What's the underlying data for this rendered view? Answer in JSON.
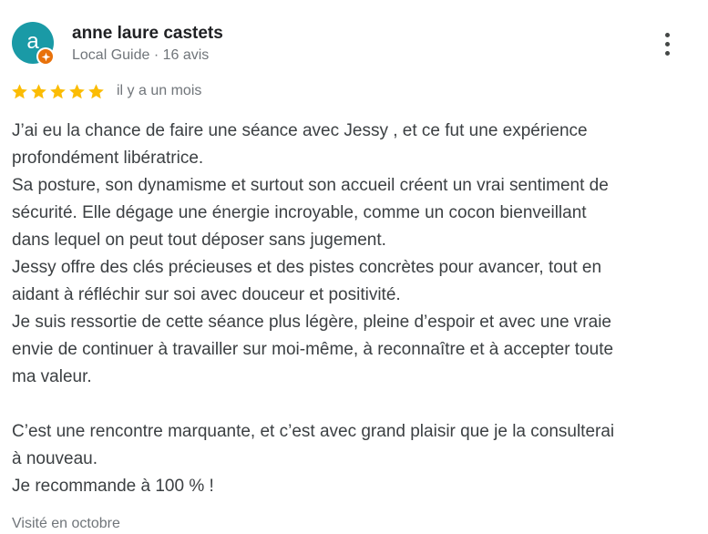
{
  "author": {
    "initial": "a",
    "name": "anne laure castets",
    "meta": "Local Guide · 16 avis"
  },
  "icons": {
    "avatar_color": "#1a9aa6",
    "badge": "local-guide-badge-icon",
    "badge_color": "#e8710a",
    "menu": "more-vert-icon",
    "star": "star-icon",
    "star_color": "#fbbc04"
  },
  "rating": {
    "stars": 5,
    "max": 5,
    "date": "il y a un mois"
  },
  "review": {
    "lines": [
      "J’ai eu la chance de faire une séance avec Jessy , et ce fut une expérience",
      "profondément libératrice.",
      "Sa posture, son dynamisme et surtout son accueil créent un vrai sentiment de",
      "sécurité. Elle dégage une énergie incroyable, comme un cocon bienveillant",
      "dans lequel on peut tout déposer sans jugement.",
      "Jessy offre des clés précieuses et des pistes concrètes pour avancer, tout en",
      "aidant à réfléchir sur soi avec douceur et positivité.",
      "Je suis ressortie de cette séance plus légère, pleine d’espoir et avec une vraie",
      "envie de continuer à travailler sur moi-même, à reconnaître et à accepter toute",
      "ma valeur.",
      "",
      "C’est une rencontre marquante, et c’est avec grand plaisir que je la consulterai",
      "à nouveau.",
      "Je recommande à 100 % !"
    ]
  },
  "visit": "Visité en octobre"
}
